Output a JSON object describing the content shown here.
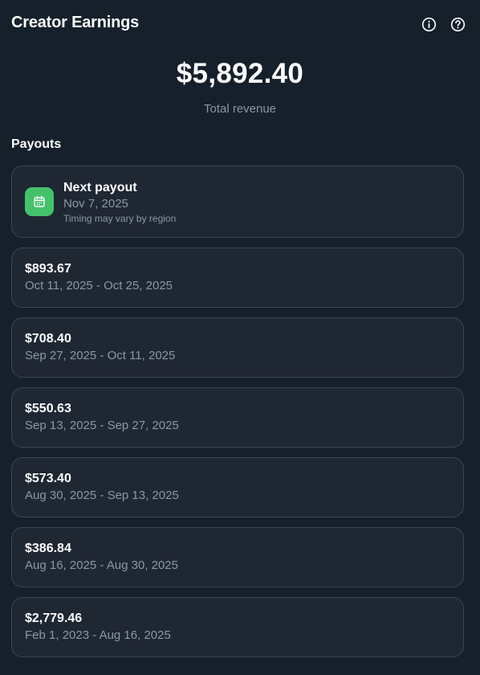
{
  "header": {
    "title": "Creator Earnings",
    "info_icon": "info-circle-icon",
    "help_icon": "question-circle-icon"
  },
  "summary": {
    "total_amount": "$5,892.40",
    "total_label": "Total revenue"
  },
  "payouts": {
    "section_title": "Payouts",
    "next": {
      "icon": "calendar-icon",
      "icon_color": "#45c16b",
      "title": "Next payout",
      "date": "Nov 7, 2025",
      "note": "Timing may vary by region"
    },
    "items": [
      {
        "amount": "$893.67",
        "range": "Oct 11, 2025 - Oct 25, 2025"
      },
      {
        "amount": "$708.40",
        "range": "Sep 27, 2025 - Oct 11, 2025"
      },
      {
        "amount": "$550.63",
        "range": "Sep 13, 2025 - Sep 27, 2025"
      },
      {
        "amount": "$573.40",
        "range": "Aug 30, 2025 - Sep 13, 2025"
      },
      {
        "amount": "$386.84",
        "range": "Aug 16, 2025 - Aug 30, 2025"
      },
      {
        "amount": "$2,779.46",
        "range": "Feb 1, 2023 - Aug 16, 2025"
      }
    ]
  },
  "colors": {
    "background": "#15202b",
    "card": "#1f2733",
    "card_border": "#3b4653",
    "secondary_text": "#8b98a5",
    "accent_green": "#45c16b"
  }
}
